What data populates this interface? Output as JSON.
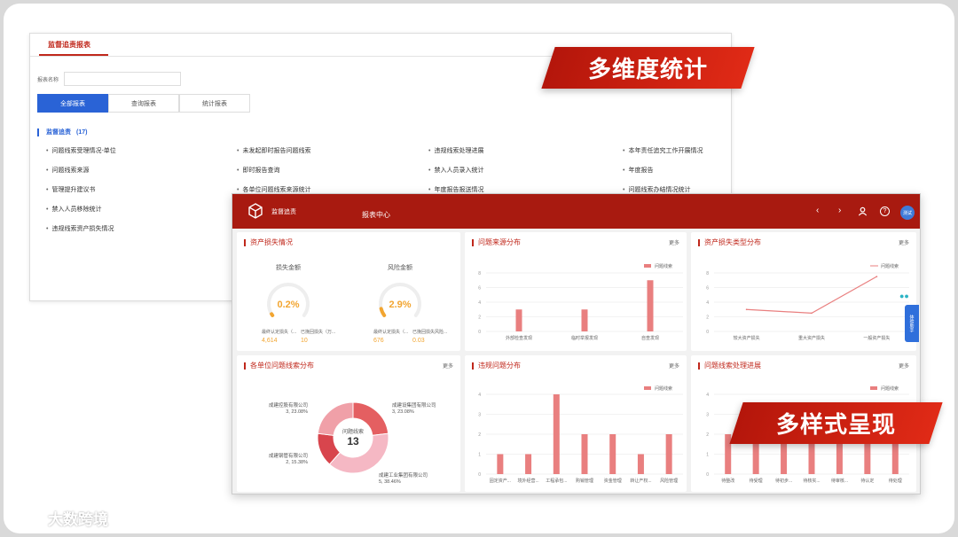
{
  "back": {
    "tab": "监督追责报表",
    "search_label": "报表名称",
    "search_placeholder": "",
    "buttons": [
      "全部报表",
      "查询报表",
      "统计报表"
    ],
    "section_title": "监督追责",
    "section_count": "(17)",
    "items": [
      [
        "问题线索受理情况-单位",
        "未发起即时报告问题线索",
        "违规线索处理进展",
        "本年责任追究工作开展情况"
      ],
      [
        "问题线索来源",
        "即时报告查询",
        "禁入人员录入统计",
        "年度报告"
      ],
      [
        "管理提升建议书",
        "各单位问题线索来源统计",
        "年度报告报送情况",
        "问题线索办结情况统计"
      ],
      [
        "禁入人员移除统计",
        "",
        "",
        ""
      ],
      [
        "违规线索资产损失情况",
        "",
        "",
        ""
      ]
    ]
  },
  "banners": {
    "top": "多维度统计",
    "bottom": "多样式呈现"
  },
  "front": {
    "brand": "监督追责",
    "title": "报表中心",
    "nav": {
      "prev": "‹",
      "next": "›",
      "help": "?"
    },
    "avatar": "测试",
    "more": "更多",
    "legend_label": "问题线索",
    "panels": {
      "asset_loss": {
        "title": "资产损失情况",
        "gauges": [
          {
            "label": "损失金额",
            "value": "0.2%",
            "fraction": 0.002,
            "stats": [
              {
                "label": "最终认定损失（...",
                "value": "4,614"
              },
              {
                "label": "已挽回损失（万...",
                "value": "10"
              }
            ]
          },
          {
            "label": "风险金额",
            "value": "2.9%",
            "fraction": 0.029,
            "stats": [
              {
                "label": "最终认定损失（...",
                "value": "676"
              },
              {
                "label": "已挽回损失风险...",
                "value": "0.03"
              }
            ]
          }
        ]
      },
      "issue_source": {
        "title": "问题来源分布"
      },
      "asset_loss_type": {
        "title": "资产损失类型分布"
      },
      "unit_issue": {
        "title": "各单位问题线索分布",
        "center_label": "问题线索",
        "center_value": "13"
      },
      "violation": {
        "title": "违规问题分布"
      },
      "issue_progress": {
        "title": "问题线索处理进展"
      }
    }
  },
  "side_tab": "体验助手",
  "watermark": "大数跨境",
  "chart_data": [
    {
      "type": "bar",
      "title": "问题来源分布",
      "categories": [
        "外部检查发现",
        "临时举报发现",
        "自查发现"
      ],
      "series": [
        {
          "name": "问题线索",
          "values": [
            3,
            3,
            7
          ]
        }
      ],
      "ylim": [
        0,
        8
      ],
      "yticks": [
        0,
        2,
        4,
        6,
        8
      ],
      "legend": "top-right",
      "grid": true
    },
    {
      "type": "line",
      "title": "资产损失类型分布",
      "categories": [
        "较大资产损失",
        "重大资产损失",
        "一般资产损失"
      ],
      "series": [
        {
          "name": "问题线索",
          "values": [
            3,
            2.5,
            7.5
          ]
        }
      ],
      "ylim": [
        0,
        8
      ],
      "yticks": [
        0,
        2,
        4,
        6,
        8
      ],
      "legend": "top-right",
      "grid": true
    },
    {
      "type": "pie",
      "title": "各单位问题线索分布",
      "total": 13,
      "slices": [
        {
          "label": "成建控股有限公司",
          "count": "3",
          "pct": "23.08%",
          "value": 23.08,
          "color": "#f0a0a8"
        },
        {
          "label": "成建设集团有限公司",
          "count": "3",
          "pct": "23.08%",
          "value": 23.08,
          "color": "#e45f61"
        },
        {
          "label": "成建工业集团有限公司",
          "count": "5",
          "pct": "38.46%",
          "value": 38.46,
          "color": "#f5b8c4"
        },
        {
          "label": "成建钢管有限公司",
          "count": "2",
          "pct": "15.38%",
          "value": 15.38,
          "color": "#d8454d"
        }
      ]
    },
    {
      "type": "bar",
      "title": "违规问题分布",
      "categories": [
        "固定资产...",
        "境外经营...",
        "工程承包...",
        "购销管理",
        "资金管理",
        "转让产权...",
        "风险管理"
      ],
      "series": [
        {
          "name": "问题线索",
          "values": [
            1,
            1,
            4,
            2,
            2,
            1,
            2
          ]
        }
      ],
      "ylim": [
        0,
        4
      ],
      "yticks": [
        0,
        1,
        2,
        3,
        4
      ],
      "legend": "top-right",
      "grid": true
    },
    {
      "type": "bar",
      "title": "问题线索处理进展",
      "categories": [
        "待整改",
        "待受理",
        "待初步...",
        "待核实...",
        "待审核...",
        "待认定",
        "待处理"
      ],
      "series": [
        {
          "name": "问题线索",
          "values": [
            2,
            3,
            2,
            2,
            2,
            3,
            3
          ]
        }
      ],
      "ylim": [
        0,
        4
      ],
      "yticks": [
        0,
        1,
        2,
        3,
        4
      ],
      "legend": "top-right",
      "grid": true
    }
  ]
}
